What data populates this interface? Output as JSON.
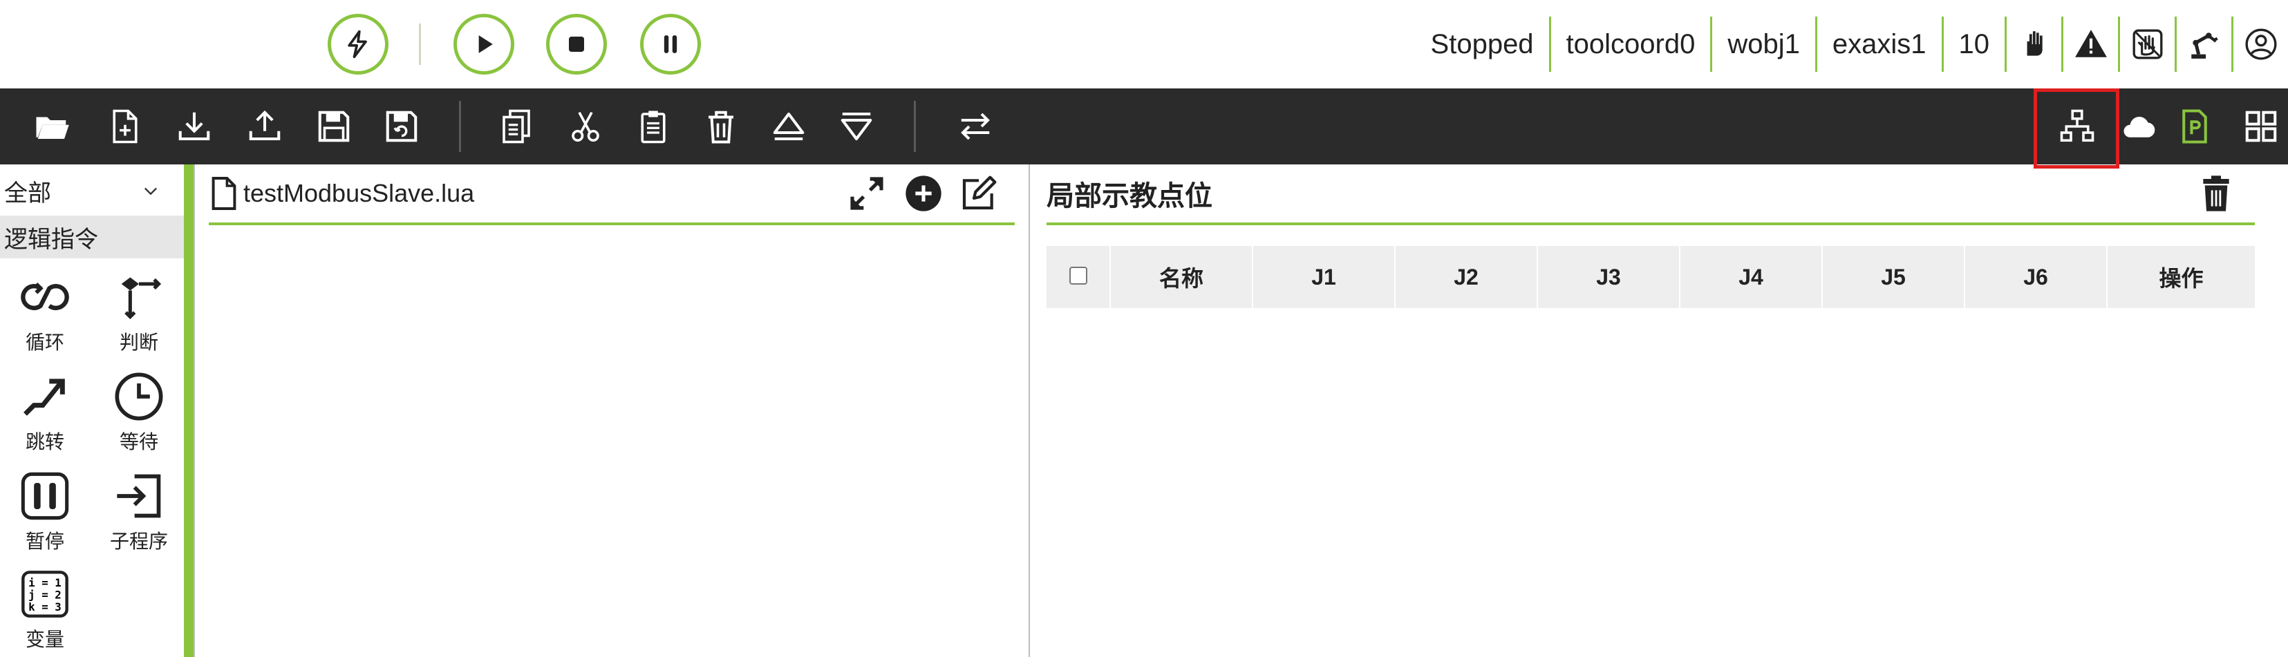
{
  "top_controls": {
    "icons": [
      "lightning-icon",
      "play-icon",
      "stop-icon",
      "pause-icon"
    ]
  },
  "status_bar": {
    "state": "Stopped",
    "tool_coord": "toolcoord0",
    "workpiece": "wobj1",
    "ext_axis": "exaxis1",
    "speed": "10",
    "icons": [
      "hand-mode-icon",
      "warning-icon",
      "drag-teach-icon",
      "robot-arm-icon",
      "user-icon"
    ]
  },
  "toolbar": {
    "left_icons": [
      "open-folder-icon",
      "new-file-icon",
      "download-icon",
      "upload-icon",
      "save-icon",
      "save-as-icon",
      "copy-icon",
      "cut-icon",
      "paste-icon",
      "delete-icon",
      "move-up-icon",
      "move-down-icon",
      "swap-icon"
    ],
    "right_icons": [
      "network-icon",
      "cloud-icon",
      "program-file-icon",
      "grid-icon"
    ],
    "accent": "#8ac43f",
    "highlight": "#e02020"
  },
  "palette": {
    "filter": "全部",
    "category": "逻辑指令",
    "commands": [
      {
        "label": "循环",
        "icon": "loop-icon"
      },
      {
        "label": "判断",
        "icon": "branch-icon"
      },
      {
        "label": "跳转",
        "icon": "jump-icon"
      },
      {
        "label": "等待",
        "icon": "clock-icon"
      },
      {
        "label": "暂停",
        "icon": "pause-icon"
      },
      {
        "label": "子程序",
        "icon": "subroutine-icon"
      },
      {
        "label": "变量",
        "icon": "variable-icon"
      }
    ]
  },
  "editor": {
    "filename": "testModbusSlave.lua"
  },
  "points": {
    "title": "局部示教点位",
    "columns": [
      "名称",
      "J1",
      "J2",
      "J3",
      "J4",
      "J5",
      "J6",
      "操作"
    ]
  }
}
